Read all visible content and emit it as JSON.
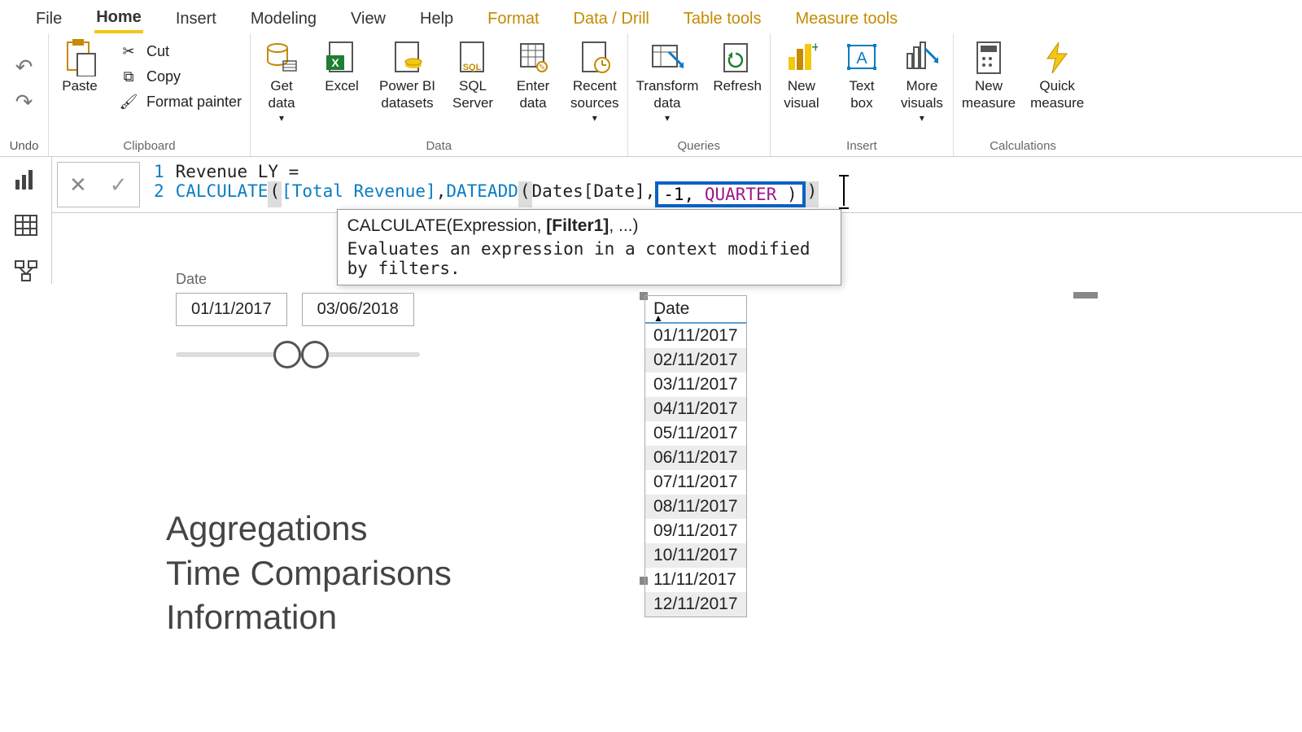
{
  "tabs": {
    "file": "File",
    "home": "Home",
    "insert": "Insert",
    "modeling": "Modeling",
    "view": "View",
    "help": "Help",
    "format": "Format",
    "data_drill": "Data / Drill",
    "table_tools": "Table tools",
    "measure_tools": "Measure tools"
  },
  "undo": {
    "label": "Undo"
  },
  "clipboard": {
    "paste": "Paste",
    "cut": "Cut",
    "copy": "Copy",
    "format_painter": "Format painter",
    "group": "Clipboard"
  },
  "data_group": {
    "get_data": "Get\ndata",
    "excel": "Excel",
    "pbi_datasets": "Power BI\ndatasets",
    "sql": "SQL\nServer",
    "enter": "Enter\ndata",
    "recent": "Recent\nsources",
    "group": "Data"
  },
  "queries": {
    "transform": "Transform\ndata",
    "refresh": "Refresh",
    "group": "Queries"
  },
  "insert_group": {
    "new_visual": "New\nvisual",
    "text_box": "Text\nbox",
    "more_visuals": "More\nvisuals",
    "group": "Insert"
  },
  "calc": {
    "new_measure": "New\nmeasure",
    "quick_measure": "Quick\nmeasure",
    "group": "Calculations"
  },
  "formula": {
    "line1_num": "1",
    "line1_txt": "Revenue LY =",
    "line2_num": "2",
    "calc": "CALCULATE",
    "lp1": "(",
    "sp1": " ",
    "totrev": "[Total Revenue]",
    "comma1": ", ",
    "dateadd": "DATEADD",
    "lp2": "(",
    "datescol": " Dates[Date]",
    "comma2": ",",
    "neg1": " -1, ",
    "quarter": "QUARTER ",
    "rp2": ")",
    "rp1": ")"
  },
  "tooltip": {
    "sig_pre": "CALCULATE(Expression, ",
    "sig_bold": "[Filter1]",
    "sig_post": ", ...)",
    "desc": "Evaluates an expression in a context modified by filters."
  },
  "slicer": {
    "title": "Date",
    "start": "01/11/2017",
    "end": "03/06/2018"
  },
  "textblock": {
    "l1": "Aggregations",
    "l2": "Time Comparisons",
    "l3": "Information"
  },
  "dtable": {
    "header": "Date",
    "rows": [
      "01/11/2017",
      "02/11/2017",
      "03/11/2017",
      "04/11/2017",
      "05/11/2017",
      "06/11/2017",
      "07/11/2017",
      "08/11/2017",
      "09/11/2017",
      "10/11/2017",
      "11/11/2017",
      "12/11/2017"
    ]
  },
  "colors": {
    "accent": "#f2c811",
    "context_tab": "#c68a00",
    "dax_fn": "#0a7dc2",
    "dax_kw": "#9b1988",
    "highlight_box": "#0a62c4"
  }
}
